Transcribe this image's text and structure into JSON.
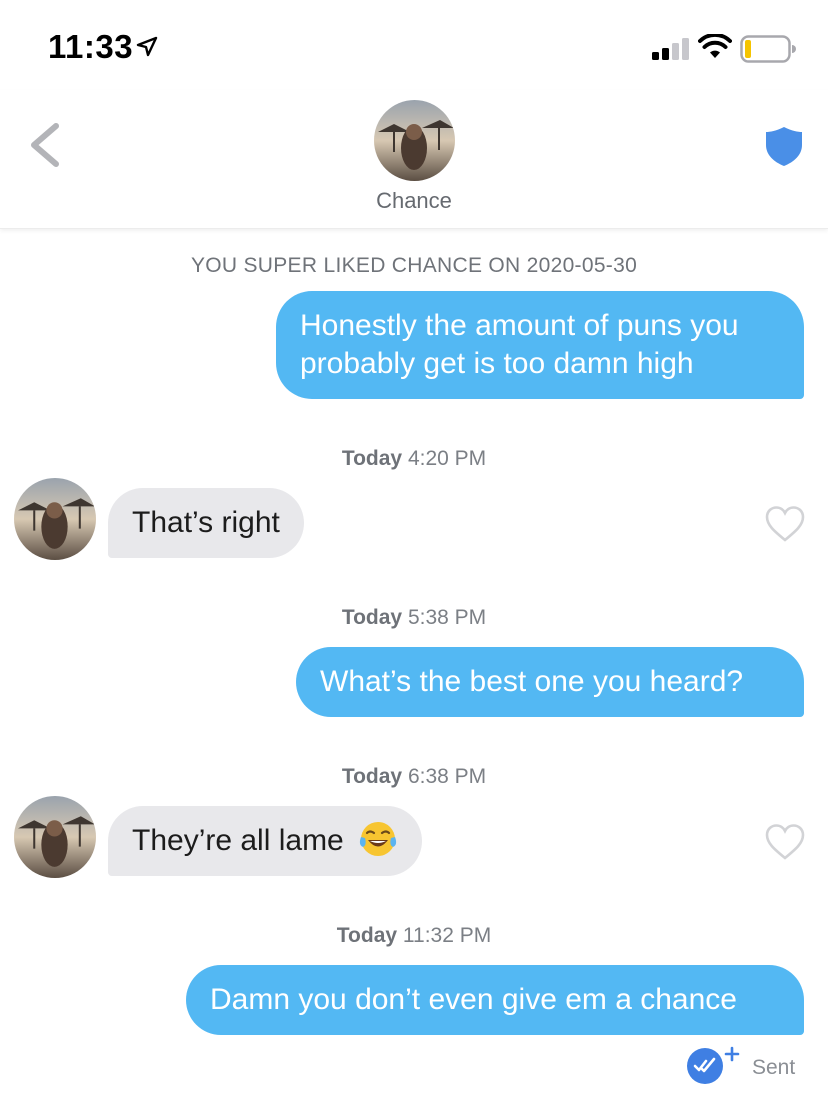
{
  "status_bar": {
    "time": "11:33",
    "icons": [
      "location-arrow-icon",
      "cellular-signal-icon",
      "wifi-icon",
      "battery-low-icon"
    ]
  },
  "header": {
    "contact_name": "Chance",
    "icons": [
      "chevron-left-icon",
      "shield-icon"
    ],
    "accent_color": "#4a8fe7"
  },
  "conversation": {
    "system_message": "YOU SUPER LIKED CHANCE ON 2020-05-30",
    "messages": [
      {
        "from": "me",
        "text_line1": "Honestly the amount of puns you",
        "text_line2": "probably get is too damn high"
      },
      {
        "timestamp_day": "Today",
        "timestamp_time": "4:20 PM"
      },
      {
        "from": "Chance",
        "text": "That’s right"
      },
      {
        "timestamp_day": "Today",
        "timestamp_time": "5:38 PM"
      },
      {
        "from": "me",
        "text": "What’s the best one you heard?"
      },
      {
        "timestamp_day": "Today",
        "timestamp_time": "6:38 PM"
      },
      {
        "from": "Chance",
        "text": "They’re all lame",
        "emoji": "face-with-tears-of-joy"
      },
      {
        "timestamp_day": "Today",
        "timestamp_time": "11:32 PM"
      },
      {
        "from": "me",
        "text": "Damn you don’t even give em a chance"
      }
    ],
    "delivery_status": "Sent",
    "outgoing_color": "#53b8f3",
    "incoming_color": "#e8e8eb"
  }
}
